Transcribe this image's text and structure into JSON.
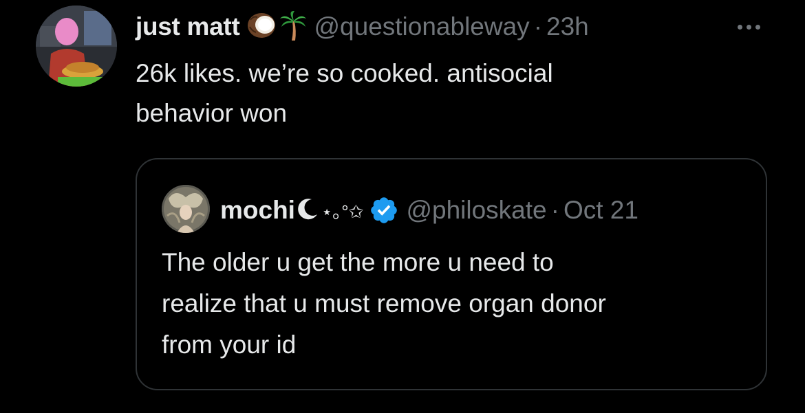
{
  "post": {
    "display_name": "just matt",
    "name_emojis": [
      "coconut-emoji",
      "palm-tree-emoji"
    ],
    "handle": "@questionableway",
    "separator": "·",
    "time": "23h",
    "more_icon": "more-horizontal-icon",
    "text": "26k likes. we’re so cooked. antisocial\nbehavior won"
  },
  "quoted": {
    "display_name": "mochi",
    "name_decoration": "⋆｡°✩",
    "verified_icon": "verified-badge-icon",
    "handle": "@philoskate",
    "separator": "·",
    "date": "Oct 21",
    "text": "The older u get the more u need to\nrealize that u must remove organ donor\nfrom your id"
  },
  "colors": {
    "background": "#000000",
    "primary_text": "#e7e9ea",
    "secondary_text": "#71767b",
    "border": "#2f3336",
    "verified_blue": "#1d9bf0"
  }
}
